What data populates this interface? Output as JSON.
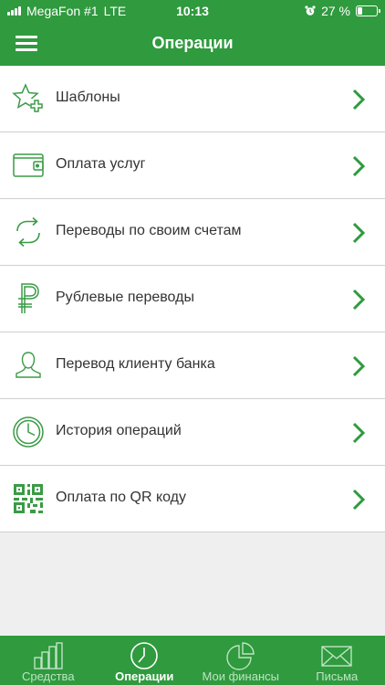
{
  "status_bar": {
    "carrier": "MegaFon #1",
    "network": "LTE",
    "time": "10:13",
    "battery_text": "27 %",
    "battery_level": 0.27
  },
  "header": {
    "title": "Операции"
  },
  "operations": [
    {
      "label": "Шаблоны",
      "icon": "star-plus-icon"
    },
    {
      "label": "Оплата услуг",
      "icon": "wallet-icon"
    },
    {
      "label": "Переводы по своим счетам",
      "icon": "transfer-arrows-icon"
    },
    {
      "label": "Рублевые переводы",
      "icon": "ruble-icon"
    },
    {
      "label": "Перевод клиенту банка",
      "icon": "person-icon"
    },
    {
      "label": "История операций",
      "icon": "clock-icon"
    },
    {
      "label": "Оплата по QR коду",
      "icon": "qr-code-icon"
    }
  ],
  "tabs": [
    {
      "label": "Средства",
      "icon": "bar-chart-icon",
      "active": false
    },
    {
      "label": "Операции",
      "icon": "clock-icon",
      "active": true
    },
    {
      "label": "Мои финансы",
      "icon": "pie-chart-icon",
      "active": false
    },
    {
      "label": "Письма",
      "icon": "envelope-icon",
      "active": false
    }
  ],
  "colors": {
    "brand_green": "#2f9a3e",
    "icon_green": "#3a9b46"
  }
}
